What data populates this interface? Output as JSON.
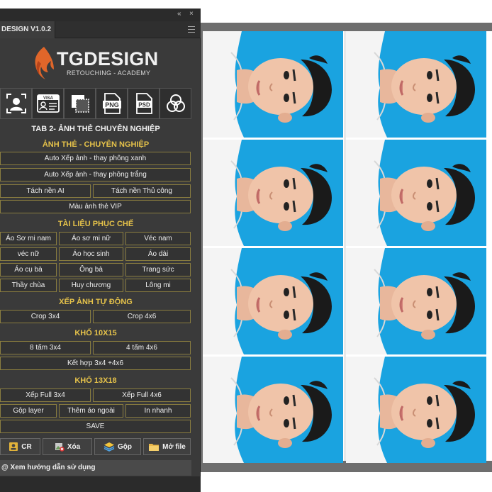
{
  "topbar": {
    "collapse_icon": "double-chevron-left-icon",
    "close_icon": "close-icon"
  },
  "tab": {
    "title": "DESIGN V1.0.2",
    "menu_icon": "hamburger-icon"
  },
  "logo": {
    "main": "TGDESIGN",
    "sub": "RETOUCHING - ACADEMY",
    "colors": {
      "flame": "#e0662a",
      "text": "#f0f0f0"
    }
  },
  "tools": [
    {
      "name": "portrait-icon",
      "label": ""
    },
    {
      "name": "visa-icon",
      "label": "VISA"
    },
    {
      "name": "layers-square-icon",
      "label": ""
    },
    {
      "name": "png-file-icon",
      "label": "PNG"
    },
    {
      "name": "psd-file-icon",
      "label": "PSD"
    },
    {
      "name": "rgb-circles-icon",
      "label": ""
    }
  ],
  "sections": {
    "tab_heading": "TAB 2- ẢNH THẺ CHUYÊN NGHIỆP",
    "anh_the": "ẢNH THẺ - CHUYÊN NGHIỆP",
    "tai_lieu": "TÀI LIỆU PHỤC CHẾ",
    "xep_anh": "XẾP ẢNH TỰ ĐỘNG",
    "kho_10x15": "KHỔ 10X15",
    "kho_13x18": "KHỔ 13X18"
  },
  "buttons": {
    "auto_xanh": "Auto Xếp ảnh - thay phông xanh",
    "auto_trang": "Auto Xếp ảnh - thay phông trắng",
    "tach_ai": "Tách nền AI",
    "tach_thu_cong": "Tách nền Thủ công",
    "mau_vip": "Màu ảnh thẻ VIP",
    "ao_so_mi_nam": "Áo Sơ mi nam",
    "ao_so_mi_nu": "Áo sơ mi nữ",
    "vec_nam": "Véc nam",
    "vec_nu": "véc nữ",
    "ao_hoc_sinh": "Áo học sinh",
    "ao_dai": "Áo dài",
    "ao_cu_ba": "Áo cụ bà",
    "ong_ba": "Ông bà",
    "trang_suc": "Trang sức",
    "thay_chua": "Thầy chùa",
    "huy_chuong": "Huy chương",
    "long_mi": "Lông mi",
    "crop_3x4": "Crop 3x4",
    "crop_4x6": "Crop 4x6",
    "tam_3x4": "8 tấm 3x4",
    "tam_4x6": "4 tấm 4x6",
    "ket_hop": "Kết hợp 3x4 +4x6",
    "full_3x4": "Xếp Full 3x4",
    "full_4x6": "Xếp Full 4x6",
    "gop_layer": "Gộp layer",
    "them_ao": "Thêm áo ngoài",
    "in_nhanh": "In nhanh",
    "save": "SAVE"
  },
  "bottom": {
    "cr": "CR",
    "xoa": "Xóa",
    "gop": "Gộp",
    "mo_file": "Mở file",
    "help": "@ Xem hướng dẫn sử dụng"
  },
  "canvas": {
    "photo_count": 8,
    "background": "#1aa3e0"
  },
  "colors": {
    "panel": "#3a3a3a",
    "button_border": "#8a7d3f",
    "gold_heading": "#e5c24a",
    "photo_bg": "#1aa3e0"
  }
}
